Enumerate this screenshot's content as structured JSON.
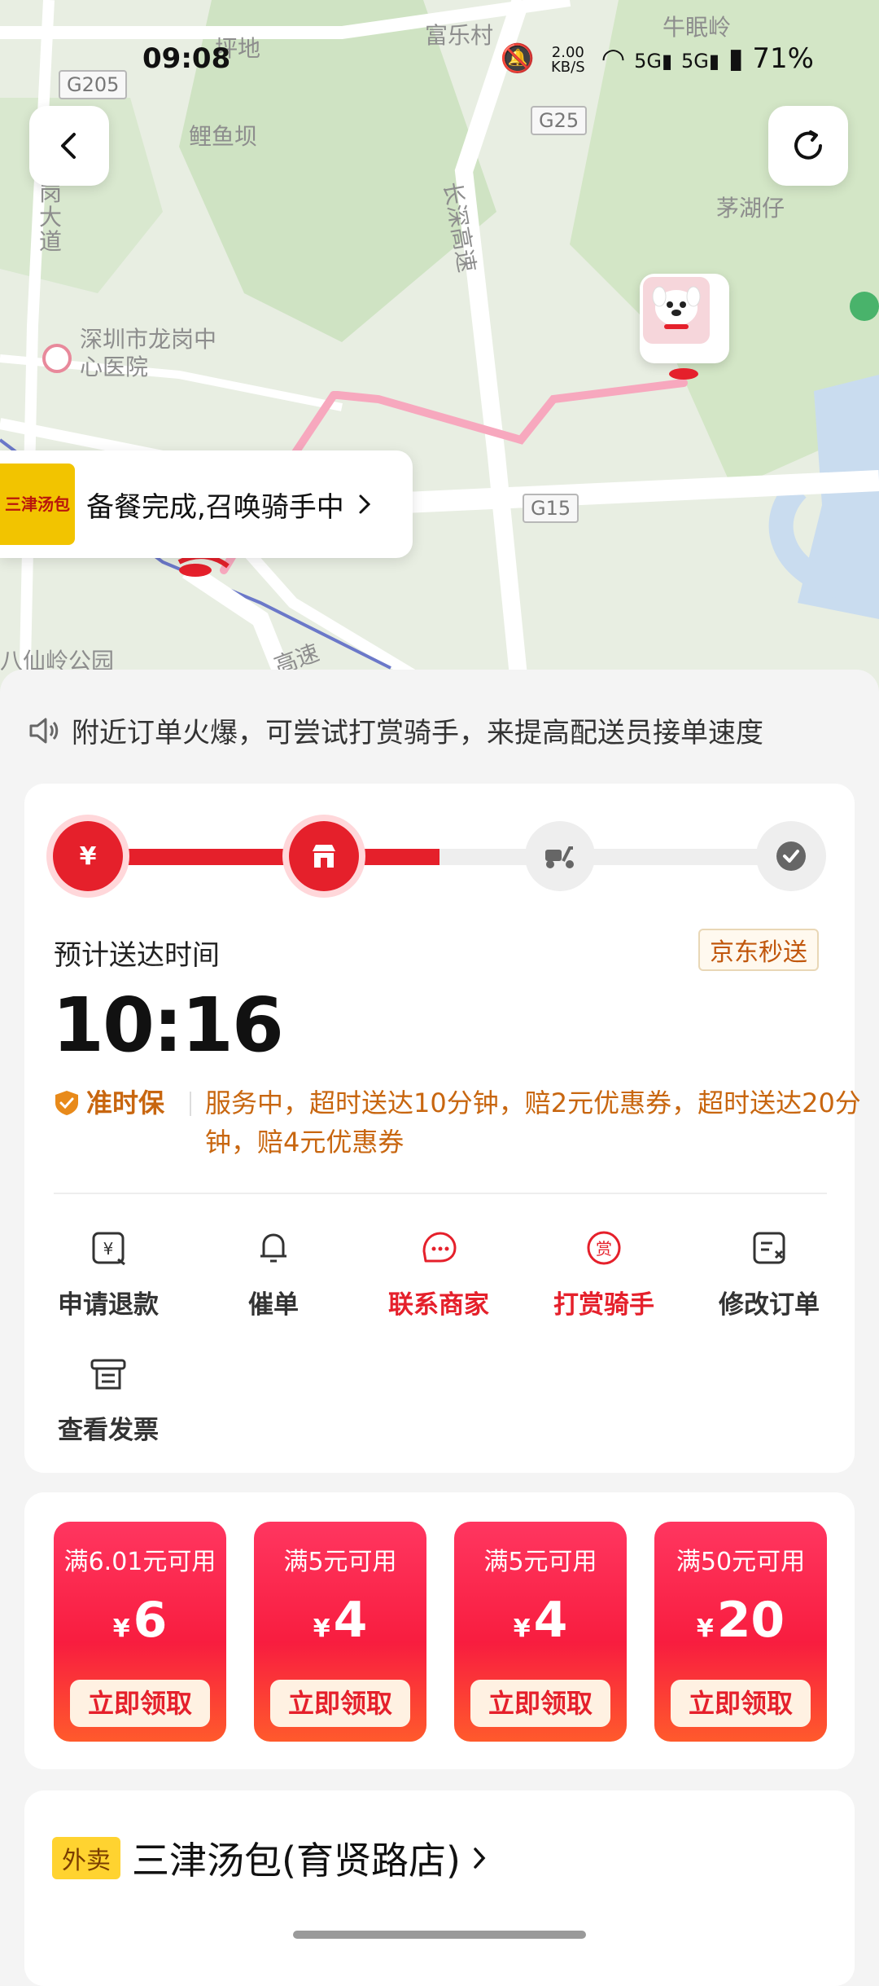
{
  "status_bar": {
    "time": "09:08",
    "net_speed": "2.00 KB/S",
    "battery": "71%"
  },
  "map": {
    "labels": [
      "坪地",
      "富乐村",
      "牛眠岭",
      "鲤鱼坝",
      "长深高速",
      "茅湖仔",
      "深圳市龙岗中心医院",
      "八仙岭公园",
      "岗大道",
      "高速"
    ],
    "road_shields": [
      "G205",
      "G25",
      "G15"
    ],
    "status_pill": {
      "shop_logo_text": "三津汤包",
      "text": "备餐完成,召唤骑手中"
    }
  },
  "notice": "附近订单火爆，可尝试打赏骑手，来提高配送员接单速度",
  "progress": {
    "steps": [
      "paid",
      "merchant",
      "delivery",
      "done"
    ],
    "completed_fraction": 0.5
  },
  "eta": {
    "label": "预计送达时间",
    "service_tag": "京东秒送",
    "time": "10:16"
  },
  "guarantee": {
    "badge": "准时保",
    "description": "服务中，超时送达10分钟，赔2元优惠券，超时送达20分钟，赔4元优惠券"
  },
  "actions": [
    {
      "label": "申请退款",
      "icon": "refund-icon",
      "highlight": false
    },
    {
      "label": "催单",
      "icon": "bell-icon",
      "highlight": false
    },
    {
      "label": "联系商家",
      "icon": "chat-shop-icon",
      "highlight": true
    },
    {
      "label": "打赏骑手",
      "icon": "reward-icon",
      "highlight": true
    },
    {
      "label": "修改订单",
      "icon": "edit-order-icon",
      "highlight": false
    },
    {
      "label": "查看发票",
      "icon": "invoice-icon",
      "highlight": false
    }
  ],
  "coupons": [
    {
      "condition": "满6.01元可用",
      "currency": "¥",
      "amount": "6",
      "button": "立即领取"
    },
    {
      "condition": "满5元可用",
      "currency": "¥",
      "amount": "4",
      "button": "立即领取"
    },
    {
      "condition": "满5元可用",
      "currency": "¥",
      "amount": "4",
      "button": "立即领取"
    },
    {
      "condition": "满50元可用",
      "currency": "¥",
      "amount": "20",
      "button": "立即领取"
    }
  ],
  "shop": {
    "tag": "外卖",
    "name": "三津汤包(育贤路店)"
  },
  "colors": {
    "accent_red": "#e5202b",
    "orange_text": "#c8660f"
  }
}
